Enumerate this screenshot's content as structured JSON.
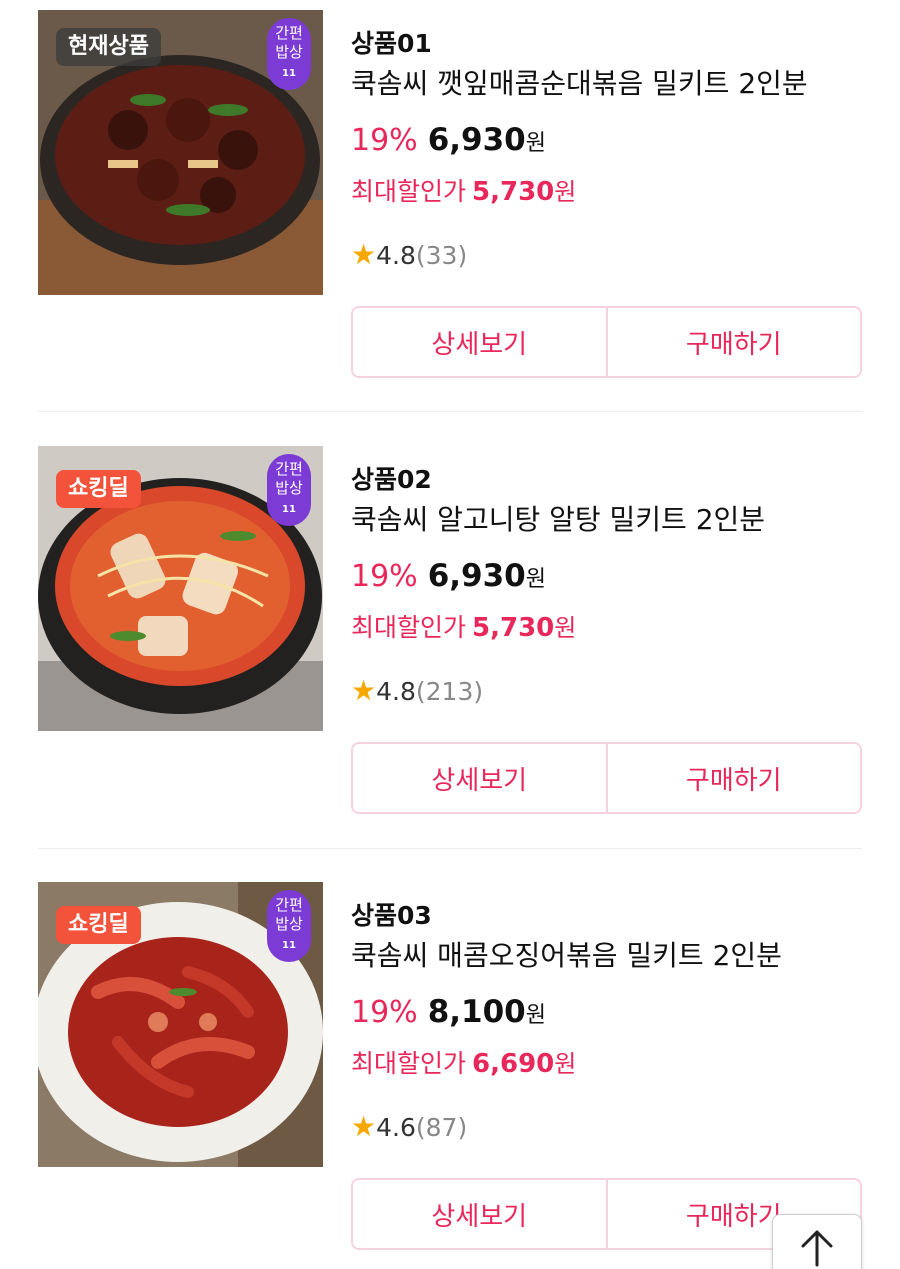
{
  "colors": {
    "accent": "#e8275a",
    "badge_red": "#f2533a",
    "tag_purple": "#7d3bd6",
    "star": "#f6a800"
  },
  "products": [
    {
      "number": "상품01",
      "name": "쿡솜씨 깻잎매콤순대볶음 밀키트 2인분",
      "badge": "현재상품",
      "tag": {
        "line1": "간편",
        "line2": "밥상",
        "logo": "11"
      },
      "discount_pct": "19%",
      "price": "6,930",
      "currency": "원",
      "max_discount_label": "최대할인가",
      "max_discount_price": "5,730",
      "max_discount_currency": "원",
      "rating": "4.8",
      "review_count": "(33)",
      "detail_button": "상세보기",
      "buy_button": "구매하기"
    },
    {
      "number": "상품02",
      "name": "쿡솜씨 알고니탕 알탕 밀키트 2인분",
      "badge": "쇼킹딜",
      "tag": {
        "line1": "간편",
        "line2": "밥상",
        "logo": "11"
      },
      "discount_pct": "19%",
      "price": "6,930",
      "currency": "원",
      "max_discount_label": "최대할인가",
      "max_discount_price": "5,730",
      "max_discount_currency": "원",
      "rating": "4.8",
      "review_count": "(213)",
      "detail_button": "상세보기",
      "buy_button": "구매하기"
    },
    {
      "number": "상품03",
      "name": "쿡솜씨 매콤오징어볶음 밀키트 2인분",
      "badge": "쇼킹딜",
      "tag": {
        "line1": "간편",
        "line2": "밥상",
        "logo": "11"
      },
      "discount_pct": "19%",
      "price": "8,100",
      "currency": "원",
      "max_discount_label": "최대할인가",
      "max_discount_price": "6,690",
      "max_discount_currency": "원",
      "rating": "4.6",
      "review_count": "(87)",
      "detail_button": "상세보기",
      "buy_button": "구매하기"
    }
  ],
  "icons": {
    "star": "star-icon",
    "scroll_top": "arrow-up-icon"
  }
}
